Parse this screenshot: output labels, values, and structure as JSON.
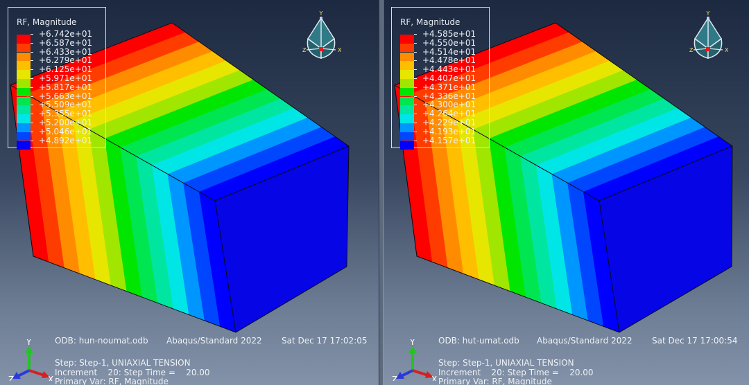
{
  "panels": [
    {
      "legend_title": "RF, Magnitude",
      "legend_values": [
        "+6.742e+01",
        "+6.587e+01",
        "+6.433e+01",
        "+6.279e+01",
        "+6.125e+01",
        "+5.971e+01",
        "+5.817e+01",
        "+5.663e+01",
        "+5.509e+01",
        "+5.355e+01",
        "+5.200e+01",
        "+5.046e+01",
        "+4.892e+01"
      ],
      "legend_colors": [
        "#ff0000",
        "#ff3c00",
        "#ff8c00",
        "#ffbe00",
        "#e6e600",
        "#a0e600",
        "#00e600",
        "#00e650",
        "#00e6a0",
        "#00e6e6",
        "#0096ff",
        "#0046ff",
        "#0000ff"
      ],
      "triad_top": {
        "y": "Y",
        "z": "Z",
        "x": "X"
      },
      "triad_bottom": {
        "y": "Y",
        "z": "Z",
        "x": "X"
      },
      "odb": "ODB: hun-noumat.odb",
      "solver": "Abaqus/Standard 2022",
      "date": "Sat Dec 17 17:02:05",
      "step": "Step: Step-1, UNIAXIAL TENSION",
      "increment": "Increment    20: Step Time =    20.00",
      "primary_var": "Primary Var: RF, Magnitude"
    },
    {
      "legend_title": "RF, Magnitude",
      "legend_values": [
        "+4.585e+01",
        "+4.550e+01",
        "+4.514e+01",
        "+4.478e+01",
        "+4.443e+01",
        "+4.407e+01",
        "+4.371e+01",
        "+4.336e+01",
        "+4.300e+01",
        "+4.264e+01",
        "+4.229e+01",
        "+4.193e+01",
        "+4.157e+01"
      ],
      "legend_colors": [
        "#ff0000",
        "#ff3c00",
        "#ff8c00",
        "#ffbe00",
        "#e6e600",
        "#a0e600",
        "#00e600",
        "#00e650",
        "#00e6a0",
        "#00e6e6",
        "#0096ff",
        "#0046ff",
        "#0000ff"
      ],
      "triad_top": {
        "y": "Y",
        "z": "Z",
        "x": "X"
      },
      "triad_bottom": {
        "y": "Y",
        "z": "Z",
        "x": "X"
      },
      "odb": "ODB: hut-umat.odb",
      "solver": "Abaqus/Standard 2022",
      "date": "Sat Dec 17 17:00:54",
      "step": "Step: Step-1, UNIAXIAL TENSION",
      "increment": "Increment    20: Step Time =    20.00",
      "primary_var": "Primary Var: RF, Magnitude"
    }
  ]
}
